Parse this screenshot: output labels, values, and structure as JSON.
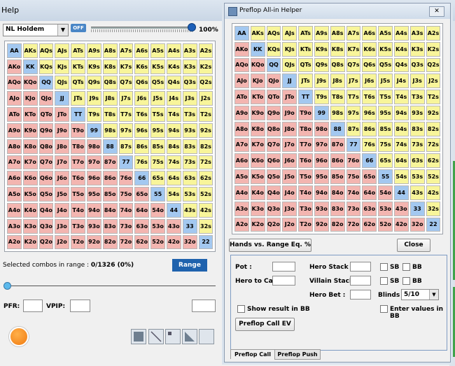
{
  "background": {
    "title": "Help",
    "game_select": "NL Holdem",
    "off_toggle": "OFF",
    "range_pct": "100%",
    "selected_label": "Selected combos in range : ",
    "selected_value": "0/1326 (0%)",
    "range_button": "Range",
    "pfr_label": "PFR:",
    "vpip_label": "VPIP:"
  },
  "dialog": {
    "title": "Preflop All-in Helper",
    "close_x": "✕",
    "hands_vs_range_button": "Hands vs. Range Eq. %",
    "close_button": "Close",
    "pot_label": "Pot :",
    "hero_stack_label": "Hero Stack :",
    "hero_to_call_label": "Hero to Call :",
    "villain_stack_label": "Villain Stack :",
    "hero_bet_label": "Hero Bet :",
    "blinds_label": "Blinds :",
    "blinds_value": "5/10",
    "sb_label": "SB",
    "bb_label": "BB",
    "show_result_label": "Show result in BB",
    "enter_values_label": "Enter values in BB",
    "preflop_call_ev_button": "Preflop Call EV",
    "tabs": [
      "Preflop Call",
      "Preflop Push"
    ]
  },
  "matrix": {
    "ranks": [
      "A",
      "K",
      "Q",
      "J",
      "T",
      "9",
      "8",
      "7",
      "6",
      "5",
      "4",
      "3",
      "2"
    ],
    "colors": {
      "suited": "#f8f59a",
      "pair": "#a3c8f0",
      "offsuit": "#f3b5b0"
    }
  }
}
